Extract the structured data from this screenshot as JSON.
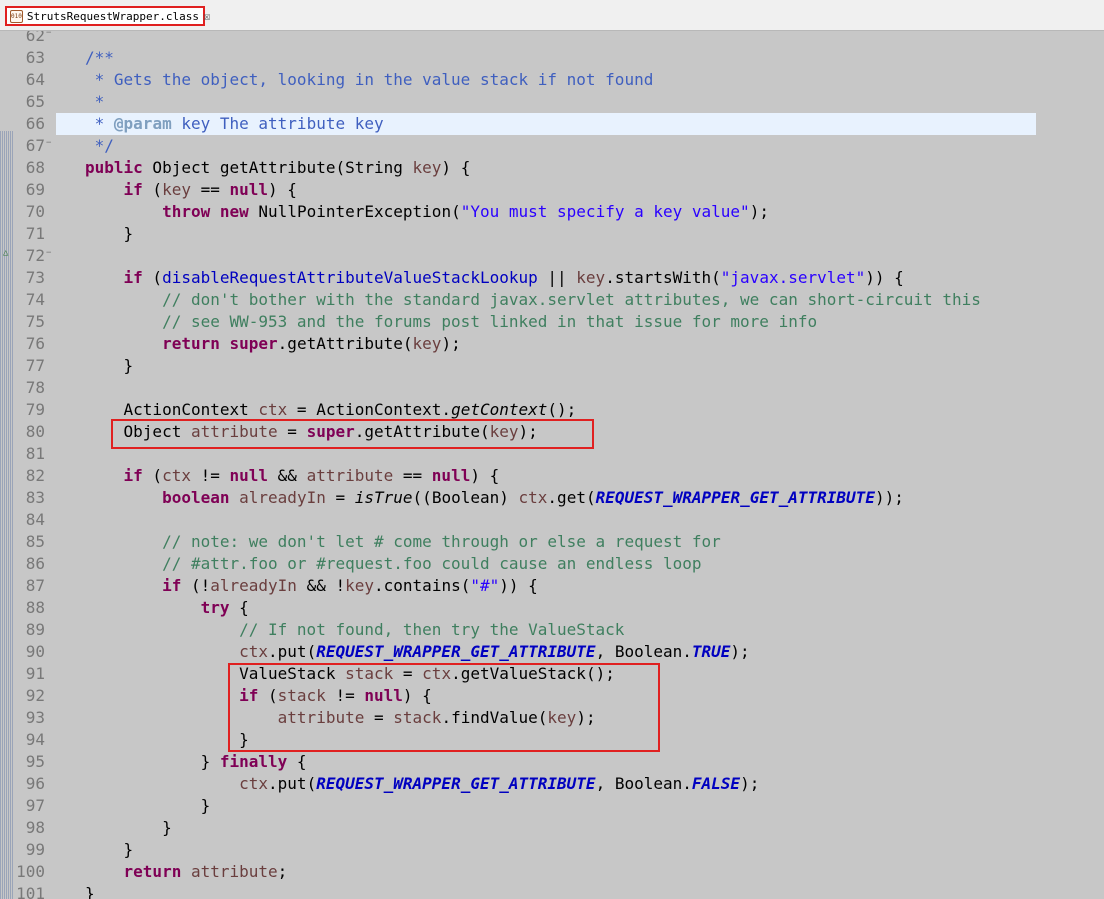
{
  "tab": {
    "label": "StrutsRequestWrapper.class",
    "icon": "class-file-icon"
  },
  "colors": {
    "keyword": "#7f0055",
    "comment": "#3f7f5f",
    "javadoc": "#3f5fbf",
    "string": "#2a00ff",
    "local_var": "#6a3e3e",
    "static_field": "#0000c0",
    "highlight_box": "#e02020",
    "current_line": "#e8f2fe"
  },
  "lines": [
    {
      "n": "62",
      "t": []
    },
    {
      "n": "63",
      "t": [
        [
          "jd",
          "/**"
        ]
      ]
    },
    {
      "n": "64",
      "t": [
        [
          "jd",
          " * Gets the object, looking in the value stack if not found"
        ]
      ]
    },
    {
      "n": "65",
      "t": [
        [
          "jd",
          " *"
        ]
      ]
    },
    {
      "n": "66",
      "t": [
        [
          "jd",
          " * "
        ],
        [
          "jt",
          "@param"
        ],
        [
          "jd",
          " key The attribute key"
        ]
      ]
    },
    {
      "n": "67",
      "t": [
        [
          "jd",
          " */"
        ]
      ]
    },
    {
      "n": "68",
      "t": [
        [
          "kw",
          "public"
        ],
        [
          "",
          " Object getAttribute(String "
        ],
        [
          "lv",
          "key"
        ],
        [
          "",
          ") {"
        ]
      ]
    },
    {
      "n": "69",
      "t": [
        [
          "",
          "    "
        ],
        [
          "kw",
          "if"
        ],
        [
          "",
          " ("
        ],
        [
          "lv",
          "key"
        ],
        [
          "",
          " == "
        ],
        [
          "kw",
          "null"
        ],
        [
          "",
          ") {"
        ]
      ]
    },
    {
      "n": "70",
      "t": [
        [
          "",
          "        "
        ],
        [
          "kw",
          "throw"
        ],
        [
          "",
          " "
        ],
        [
          "kw",
          "new"
        ],
        [
          "",
          " NullPointerException("
        ],
        [
          "st",
          "\"You must specify a key value\""
        ],
        [
          "",
          ");"
        ]
      ]
    },
    {
      "n": "71",
      "t": [
        [
          "",
          "    }"
        ]
      ]
    },
    {
      "n": "72",
      "t": []
    },
    {
      "n": "73",
      "t": [
        [
          "",
          "    "
        ],
        [
          "kw",
          "if"
        ],
        [
          "",
          " ("
        ],
        [
          "sf_plain",
          "disableRequestAttributeValueStackLookup"
        ],
        [
          "",
          " || "
        ],
        [
          "lv",
          "key"
        ],
        [
          "",
          ".startsWith("
        ],
        [
          "st",
          "\"javax.servlet\""
        ],
        [
          "",
          ")) {"
        ]
      ]
    },
    {
      "n": "74",
      "t": [
        [
          "",
          "        "
        ],
        [
          "cm",
          "// don't bother with the standard javax.servlet attributes, we can short-circuit this"
        ]
      ]
    },
    {
      "n": "75",
      "t": [
        [
          "",
          "        "
        ],
        [
          "cm",
          "// see WW-953 and the forums post linked in that issue for more info"
        ]
      ]
    },
    {
      "n": "76",
      "t": [
        [
          "",
          "        "
        ],
        [
          "kw",
          "return"
        ],
        [
          "",
          " "
        ],
        [
          "kw",
          "super"
        ],
        [
          "",
          ".getAttribute("
        ],
        [
          "lv",
          "key"
        ],
        [
          "",
          ");"
        ]
      ]
    },
    {
      "n": "77",
      "t": [
        [
          "",
          "    }"
        ]
      ]
    },
    {
      "n": "78",
      "t": []
    },
    {
      "n": "79",
      "t": [
        [
          "",
          "    ActionContext "
        ],
        [
          "lv",
          "ctx"
        ],
        [
          "",
          " = ActionContext."
        ],
        [
          "sm",
          "getContext"
        ],
        [
          "",
          "();"
        ]
      ]
    },
    {
      "n": "80",
      "t": [
        [
          "",
          "    Object "
        ],
        [
          "lv",
          "attribute"
        ],
        [
          "",
          " = "
        ],
        [
          "kw",
          "super"
        ],
        [
          "",
          ".getAttribute("
        ],
        [
          "lv",
          "key"
        ],
        [
          "",
          ");"
        ]
      ]
    },
    {
      "n": "81",
      "t": []
    },
    {
      "n": "82",
      "t": [
        [
          "",
          "    "
        ],
        [
          "kw",
          "if"
        ],
        [
          "",
          " ("
        ],
        [
          "lv",
          "ctx"
        ],
        [
          "",
          " != "
        ],
        [
          "kw",
          "null"
        ],
        [
          "",
          " && "
        ],
        [
          "lv",
          "attribute"
        ],
        [
          "",
          " == "
        ],
        [
          "kw",
          "null"
        ],
        [
          "",
          ") {"
        ]
      ]
    },
    {
      "n": "83",
      "t": [
        [
          "",
          "        "
        ],
        [
          "kw",
          "boolean"
        ],
        [
          "",
          " "
        ],
        [
          "lv",
          "alreadyIn"
        ],
        [
          "",
          " = "
        ],
        [
          "sm",
          "isTrue"
        ],
        [
          "",
          "((Boolean) "
        ],
        [
          "lv",
          "ctx"
        ],
        [
          "",
          ".get("
        ],
        [
          "sf",
          "REQUEST_WRAPPER_GET_ATTRIBUTE"
        ],
        [
          "",
          "));"
        ]
      ]
    },
    {
      "n": "84",
      "t": []
    },
    {
      "n": "85",
      "t": [
        [
          "",
          "        "
        ],
        [
          "cm",
          "// note: we don't let # come through or else a request for"
        ]
      ]
    },
    {
      "n": "86",
      "t": [
        [
          "",
          "        "
        ],
        [
          "cm",
          "// #attr.foo or #request.foo could cause an endless loop"
        ]
      ]
    },
    {
      "n": "87",
      "t": [
        [
          "",
          "        "
        ],
        [
          "kw",
          "if"
        ],
        [
          "",
          " (!"
        ],
        [
          "lv",
          "alreadyIn"
        ],
        [
          "",
          " && !"
        ],
        [
          "lv",
          "key"
        ],
        [
          "",
          ".contains("
        ],
        [
          "st",
          "\"#\""
        ],
        [
          "",
          ")) {"
        ]
      ]
    },
    {
      "n": "88",
      "t": [
        [
          "",
          "            "
        ],
        [
          "kw",
          "try"
        ],
        [
          "",
          " {"
        ]
      ]
    },
    {
      "n": "89",
      "t": [
        [
          "",
          "                "
        ],
        [
          "cm",
          "// If not found, then try the ValueStack"
        ]
      ]
    },
    {
      "n": "90",
      "t": [
        [
          "",
          "                "
        ],
        [
          "lv",
          "ctx"
        ],
        [
          "",
          ".put("
        ],
        [
          "sf",
          "REQUEST_WRAPPER_GET_ATTRIBUTE"
        ],
        [
          "",
          ", Boolean."
        ],
        [
          "sf",
          "TRUE"
        ],
        [
          "",
          ");"
        ]
      ]
    },
    {
      "n": "91",
      "t": [
        [
          "",
          "                ValueStack "
        ],
        [
          "lv",
          "stack"
        ],
        [
          "",
          " = "
        ],
        [
          "lv",
          "ctx"
        ],
        [
          "",
          ".getValueStack();"
        ]
      ]
    },
    {
      "n": "92",
      "t": [
        [
          "",
          "                "
        ],
        [
          "kw",
          "if"
        ],
        [
          "",
          " ("
        ],
        [
          "lv",
          "stack"
        ],
        [
          "",
          " != "
        ],
        [
          "kw",
          "null"
        ],
        [
          "",
          ") {"
        ]
      ]
    },
    {
      "n": "93",
      "t": [
        [
          "",
          "                    "
        ],
        [
          "lv",
          "attribute"
        ],
        [
          "",
          " = "
        ],
        [
          "lv",
          "stack"
        ],
        [
          "",
          ".findValue("
        ],
        [
          "lv",
          "key"
        ],
        [
          "",
          ");"
        ]
      ]
    },
    {
      "n": "94",
      "t": [
        [
          "",
          "                }"
        ]
      ]
    },
    {
      "n": "95",
      "t": [
        [
          "",
          "            } "
        ],
        [
          "kw",
          "finally"
        ],
        [
          "",
          " {"
        ]
      ]
    },
    {
      "n": "96",
      "t": [
        [
          "",
          "                "
        ],
        [
          "lv",
          "ctx"
        ],
        [
          "",
          ".put("
        ],
        [
          "sf",
          "REQUEST_WRAPPER_GET_ATTRIBUTE"
        ],
        [
          "",
          ", Boolean."
        ],
        [
          "sf",
          "FALSE"
        ],
        [
          "",
          ");"
        ]
      ]
    },
    {
      "n": "97",
      "t": [
        [
          "",
          "            }"
        ]
      ]
    },
    {
      "n": "98",
      "t": [
        [
          "",
          "        }"
        ]
      ]
    },
    {
      "n": "99",
      "t": [
        [
          "",
          "    }"
        ]
      ]
    },
    {
      "n": "100",
      "t": [
        [
          "",
          "    "
        ],
        [
          "kw",
          "return"
        ],
        [
          "",
          " "
        ],
        [
          "lv",
          "attribute"
        ],
        [
          "",
          ";"
        ]
      ]
    },
    {
      "n": "101",
      "t": [
        [
          "",
          "}"
        ]
      ]
    }
  ]
}
